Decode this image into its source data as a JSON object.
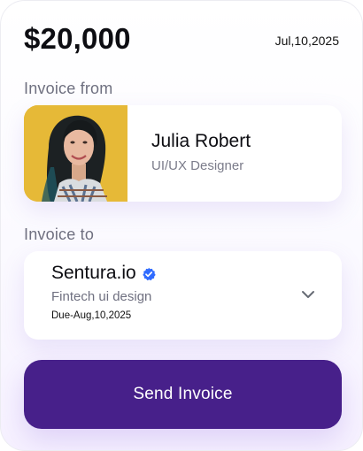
{
  "invoice": {
    "amount": "$20,000",
    "date": "Jul,10,2025"
  },
  "from_section": {
    "label": "Invoice from",
    "person": {
      "name": "Julia Robert",
      "role": "UI/UX Designer"
    }
  },
  "to_section": {
    "label": "Invoice to",
    "company": {
      "name": "Sentura.io",
      "verified_icon": "verified-check-icon",
      "project": "Fintech ui design",
      "due": "Due-Aug,10,2025"
    },
    "expand_icon": "chevron-down-icon"
  },
  "actions": {
    "send_label": "Send Invoice"
  },
  "colors": {
    "primary": "#47208a",
    "verified": "#2f6bff",
    "muted_text": "#6f7080"
  }
}
